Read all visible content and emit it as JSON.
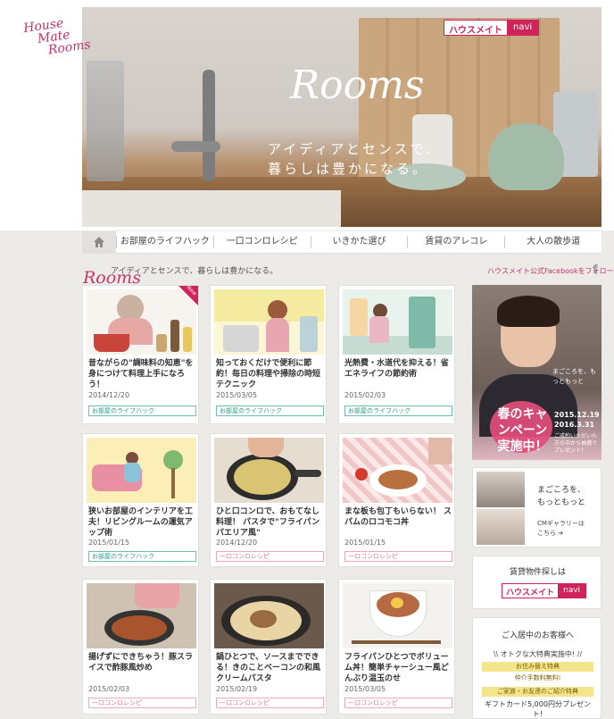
{
  "header": {
    "logo_lines": [
      "House",
      "Mate",
      "Rooms"
    ],
    "brand_badge_left": "ハウスメイト",
    "brand_badge_right": "navi",
    "hero_script": "Rooms",
    "hero_tagline_1": "アイディアとセンスで、",
    "hero_tagline_2": "暮らしは豊かになる。"
  },
  "nav": {
    "home_icon": "home-icon",
    "items": [
      "お部屋のライフハック",
      "一口コンロレシピ",
      "いきかた選び",
      "賃貸のアレコレ",
      "大人の散歩道"
    ]
  },
  "subheader": {
    "rooms_script": "Rooms",
    "tagline": "アイディアとセンスで、暮らしは豊かになる。",
    "facebook_follow": "ハウスメイト公式Facebookをフォロー",
    "facebook_icon": "f"
  },
  "cards": [
    {
      "title": "昔ながらの\"調味料の知恵\"を身につけて料理上手になろう！",
      "date": "2014/12/20",
      "tag": "お部屋のライフハック",
      "tag_color": "teal",
      "new": "New"
    },
    {
      "title": "知っておくだけで便利に節約！毎日の料理や掃除の時短テクニック",
      "date": "2015/03/05",
      "tag": "お部屋のライフハック",
      "tag_color": "teal"
    },
    {
      "title": "光熱費・水道代を抑える！省エネライフの節約術",
      "date": "2015/02/03",
      "tag": "お部屋のライフハック",
      "tag_color": "teal"
    },
    {
      "title": "狭いお部屋のインテリアを工夫！リビングルームの運気アップ術",
      "date": "2015/01/15",
      "tag": "お部屋のライフハック",
      "tag_color": "teal"
    },
    {
      "title": "ひと口コンロで、おもてなし料理！ パスタで\"フライパンパエリア風\"",
      "date": "2014/12/20",
      "tag": "一口コンロレシピ",
      "tag_color": "pink"
    },
    {
      "title": "まな板も包丁もいらない！ スパムのロコモコ丼",
      "date": "2015/01/15",
      "tag": "一口コンロレシピ",
      "tag_color": "pink"
    },
    {
      "title": "揚げずにできちゃう！豚スライスで酢豚風炒め",
      "date": "2015/02/03",
      "tag": "一口コンロレシピ",
      "tag_color": "pink"
    },
    {
      "title": "鍋ひとつで、ソースまでできる！きのことベーコンの和風クリームパスタ",
      "date": "2015/02/19",
      "tag": "一口コンロレシピ",
      "tag_color": "pink"
    },
    {
      "title": "フライパンひとつでボリューム丼！簡単チャーシュー風どんぶり温玉のせ",
      "date": "2015/03/05",
      "tag": "一口コンロレシピ",
      "tag_color": "pink"
    }
  ],
  "sidebar": {
    "banner": {
      "magokoro": "まごころを、もっともっと",
      "campaign": "春のキャンペーン実施中！",
      "date_1": "2015.12.19",
      "date_2": "2016.3.31",
      "note": "ご成約いただいた方の中から抽選でプレゼント！"
    },
    "cm": {
      "line_1": "まごころを、",
      "line_2": "もっともっと",
      "gallery_1": "CMギャラリーは",
      "gallery_2": "こちら ➔"
    },
    "search": {
      "label": "賃貸物件探しは",
      "badge_left": "ハウスメイト",
      "badge_right": "navi"
    },
    "welcome": {
      "title": "ご入居中のお客様へ",
      "headline": "\\\\ オトクな大特典実施中! //",
      "item_1": "お住み替え特典",
      "item_2": "仲介手数料無料!",
      "item_3": "ご家族・お友達のご紹介特典",
      "item_4": "ギフトカード5,000円分プレゼント!"
    }
  }
}
